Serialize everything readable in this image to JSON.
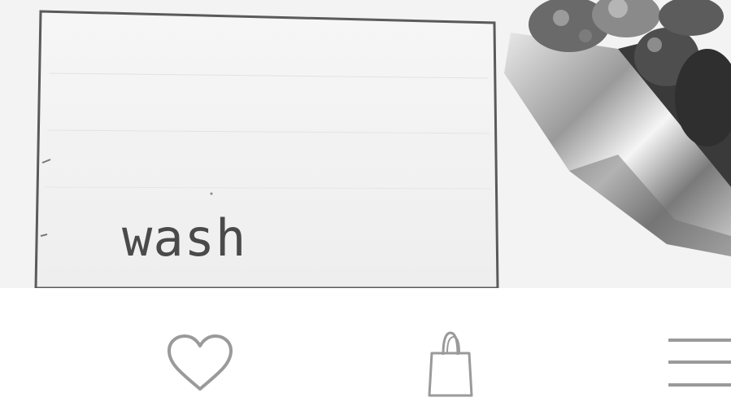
{
  "photo": {
    "sign_word": "wash",
    "colors": {
      "sign_wood": "#f1f1f1",
      "sign_edge": "#555555",
      "wall": "#f4f4f4",
      "chrome": "#bdbdbd",
      "succulent": "#5a5a5a"
    }
  },
  "bottom_nav": {
    "items": [
      {
        "name": "favorites",
        "icon": "heart-icon"
      },
      {
        "name": "shop",
        "icon": "shopping-bag-icon"
      },
      {
        "name": "menu",
        "icon": "hamburger-menu-icon"
      }
    ],
    "icon_color": "#9a9a9a"
  }
}
